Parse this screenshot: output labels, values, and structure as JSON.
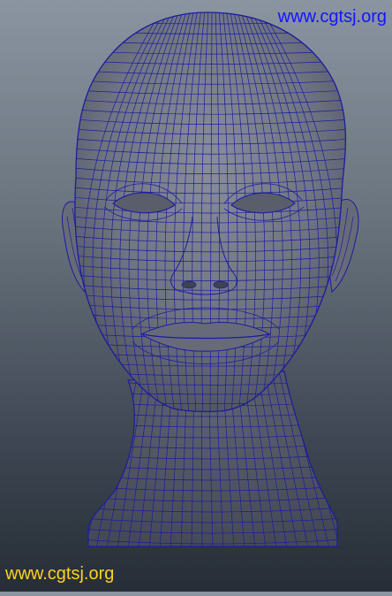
{
  "watermark": {
    "top_text": "www.cgtsj.org",
    "bottom_text": "www.cgtsj.org",
    "top_color": "#1414ff",
    "bottom_color": "#ffd21e"
  },
  "viewport": {
    "background_top": "#8a95a1",
    "background_bottom": "#262d36",
    "mesh_color": "#1c1c9e",
    "surface_color": "#6e7382",
    "subject": "wireframe polygon mesh of a human head and neck, front view"
  }
}
